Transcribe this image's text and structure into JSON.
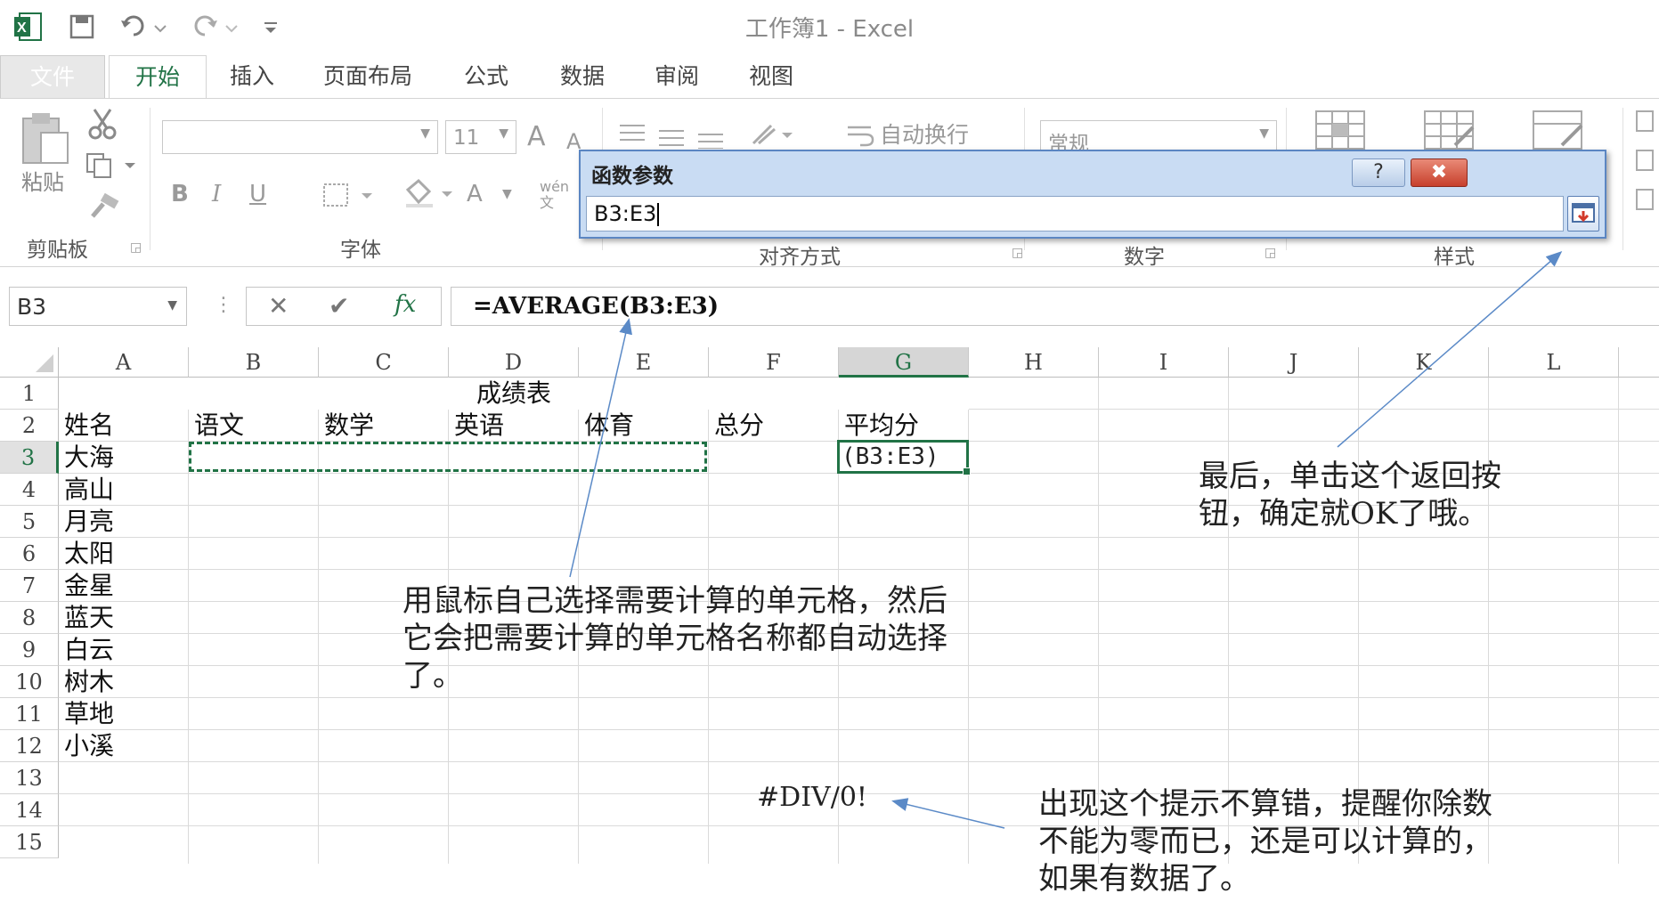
{
  "title_bar": {
    "title": "工作簿1 - Excel",
    "excel_icon": "excel-icon",
    "save_icon": "save-icon",
    "undo_icon": "undo-icon",
    "redo_icon": "redo-icon",
    "customize_icon": "customize-qat-icon"
  },
  "tabs": [
    "文件",
    "开始",
    "插入",
    "页面布局",
    "公式",
    "数据",
    "审阅",
    "视图"
  ],
  "active_tab": "开始",
  "ribbon": {
    "paste_label": "粘贴",
    "clipboard_group": "剪贴板",
    "font_group": "字体",
    "font_size": "11",
    "bold": "B",
    "italic": "I",
    "underline": "U",
    "font_color_letter": "A",
    "font_grow": "A",
    "font_shrink": "A",
    "wen": "wén\n文",
    "wrap_text": "自动换行",
    "alignment_group": "对齐方式",
    "number_format": "常规",
    "number_group": "数字",
    "styles_group": "样式"
  },
  "dialog": {
    "title": "函数参数",
    "help": "?",
    "close": "✖",
    "input_value": "B3:E3"
  },
  "formula_bar": {
    "name_box": "B3",
    "cancel": "✕",
    "enter": "✔",
    "fx": "fx",
    "formula": "=AVERAGE(B3:E3)"
  },
  "sheet": {
    "columns": [
      "A",
      "B",
      "C",
      "D",
      "E",
      "F",
      "G",
      "H",
      "I",
      "J",
      "K",
      "L"
    ],
    "rows": [
      "1",
      "2",
      "3",
      "4",
      "5",
      "6",
      "7",
      "8",
      "9",
      "10",
      "11",
      "12",
      "13",
      "14",
      "15"
    ],
    "title_cell": "成绩表",
    "headers": [
      "姓名",
      "语文",
      "数学",
      "英语",
      "体育",
      "总分",
      "平均分"
    ],
    "names": [
      "大海",
      "高山",
      "月亮",
      "太阳",
      "金星",
      "蓝天",
      "白云",
      "树木",
      "草地",
      "小溪"
    ],
    "g3_value": "(B3:E3)"
  },
  "annotations": {
    "select_cells": "用鼠标自己选择需要计算的单元格，然后它会把需要计算的单元格名称都自动选择了。",
    "return_button": "最后，单击这个返回按钮，确定就OK了哦。",
    "div_error_value": "#DIV/0!",
    "div_error_note": "出现这个提示不算错，提醒你除数不能为零而已，还是可以计算的，如果有数据了。"
  },
  "colors": {
    "accent": "#217346",
    "dialog_bg": "#c9dcf3",
    "close_red": "#c7402c",
    "arrow": "#5b8ac7"
  }
}
